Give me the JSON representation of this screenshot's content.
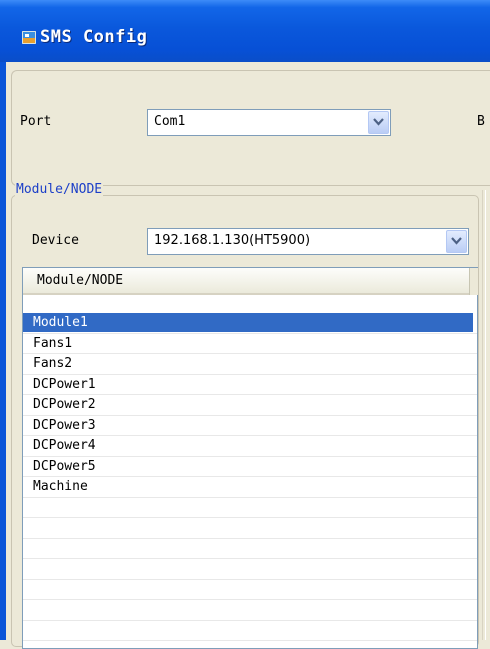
{
  "window": {
    "title": "SMS Config"
  },
  "port": {
    "label": "Port",
    "value": "Com1"
  },
  "truncated_label": "B",
  "module_group": {
    "legend": "Module/NODE",
    "device_label": "Device",
    "device_value": "192.168.1.130(HT5900)"
  },
  "list": {
    "header": "Module/NODE",
    "items": [
      "Module1",
      "Fans1",
      "Fans2",
      "DCPower1",
      "DCPower2",
      "DCPower3",
      "DCPower4",
      "DCPower5",
      "Machine"
    ],
    "selected": "Module1"
  },
  "colors": {
    "titlebar": "#0a58dc",
    "selection": "#316ac5",
    "group_legend": "#1c3fc8"
  },
  "icons": {
    "app": "sms-config-app-icon",
    "dropdown": "chevron-down-icon"
  }
}
